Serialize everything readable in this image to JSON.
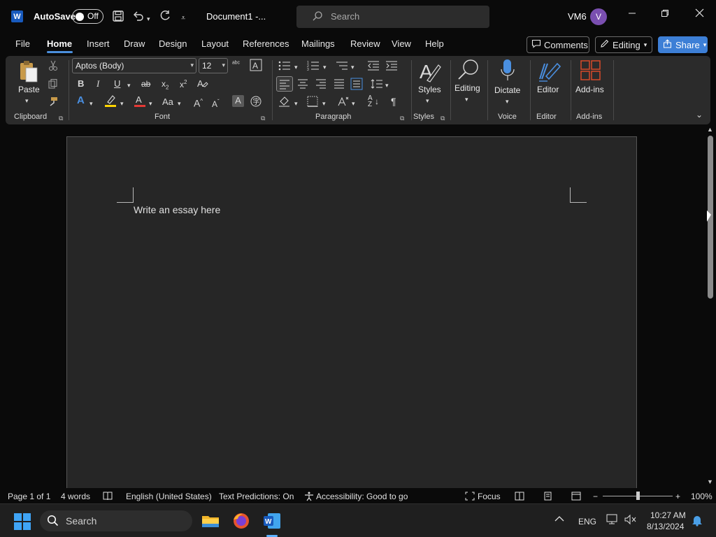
{
  "titlebar": {
    "app_logo": "W",
    "autosave_label": "AutoSave",
    "autosave_state": "Off",
    "doc_title": "Document1  -...",
    "search_placeholder": "Search",
    "user_name": "VM6",
    "avatar_initial": "V"
  },
  "tabs": {
    "items": [
      "File",
      "Home",
      "Insert",
      "Draw",
      "Design",
      "Layout",
      "References",
      "Mailings",
      "Review",
      "View",
      "Help"
    ],
    "active": "Home",
    "comments_label": "Comments",
    "editing_label": "Editing",
    "share_label": "Share"
  },
  "ribbon": {
    "clipboard": {
      "paste_label": "Paste",
      "group_label": "Clipboard"
    },
    "font": {
      "font_name": "Aptos (Body)",
      "font_size": "12",
      "change_case": "Aa",
      "group_label": "Font"
    },
    "paragraph": {
      "group_label": "Paragraph"
    },
    "styles": {
      "label": "Styles",
      "group_label": "Styles"
    },
    "editing": {
      "label": "Editing"
    },
    "voice": {
      "label": "Dictate",
      "group_label": "Voice"
    },
    "editor": {
      "label": "Editor",
      "group_label": "Editor"
    },
    "addins": {
      "label": "Add-ins",
      "group_label": "Add-ins"
    }
  },
  "document": {
    "text": "Write an essay here"
  },
  "statusbar": {
    "page": "Page 1 of 1",
    "words": "4 words",
    "language": "English (United States)",
    "text_predictions": "Text Predictions: On",
    "accessibility": "Accessibility: Good to go",
    "focus": "Focus",
    "zoom": "100%",
    "zoom_minus": "−",
    "zoom_plus": "+"
  },
  "taskbar": {
    "search_placeholder": "Search",
    "lang": "ENG",
    "time": "10:27 AM",
    "date": "8/13/2024"
  },
  "colors": {
    "accent": "#3d7fd6",
    "word_blue": "#185abd",
    "font_color_red": "#e53935",
    "highlight_yellow": "#ffd400"
  }
}
